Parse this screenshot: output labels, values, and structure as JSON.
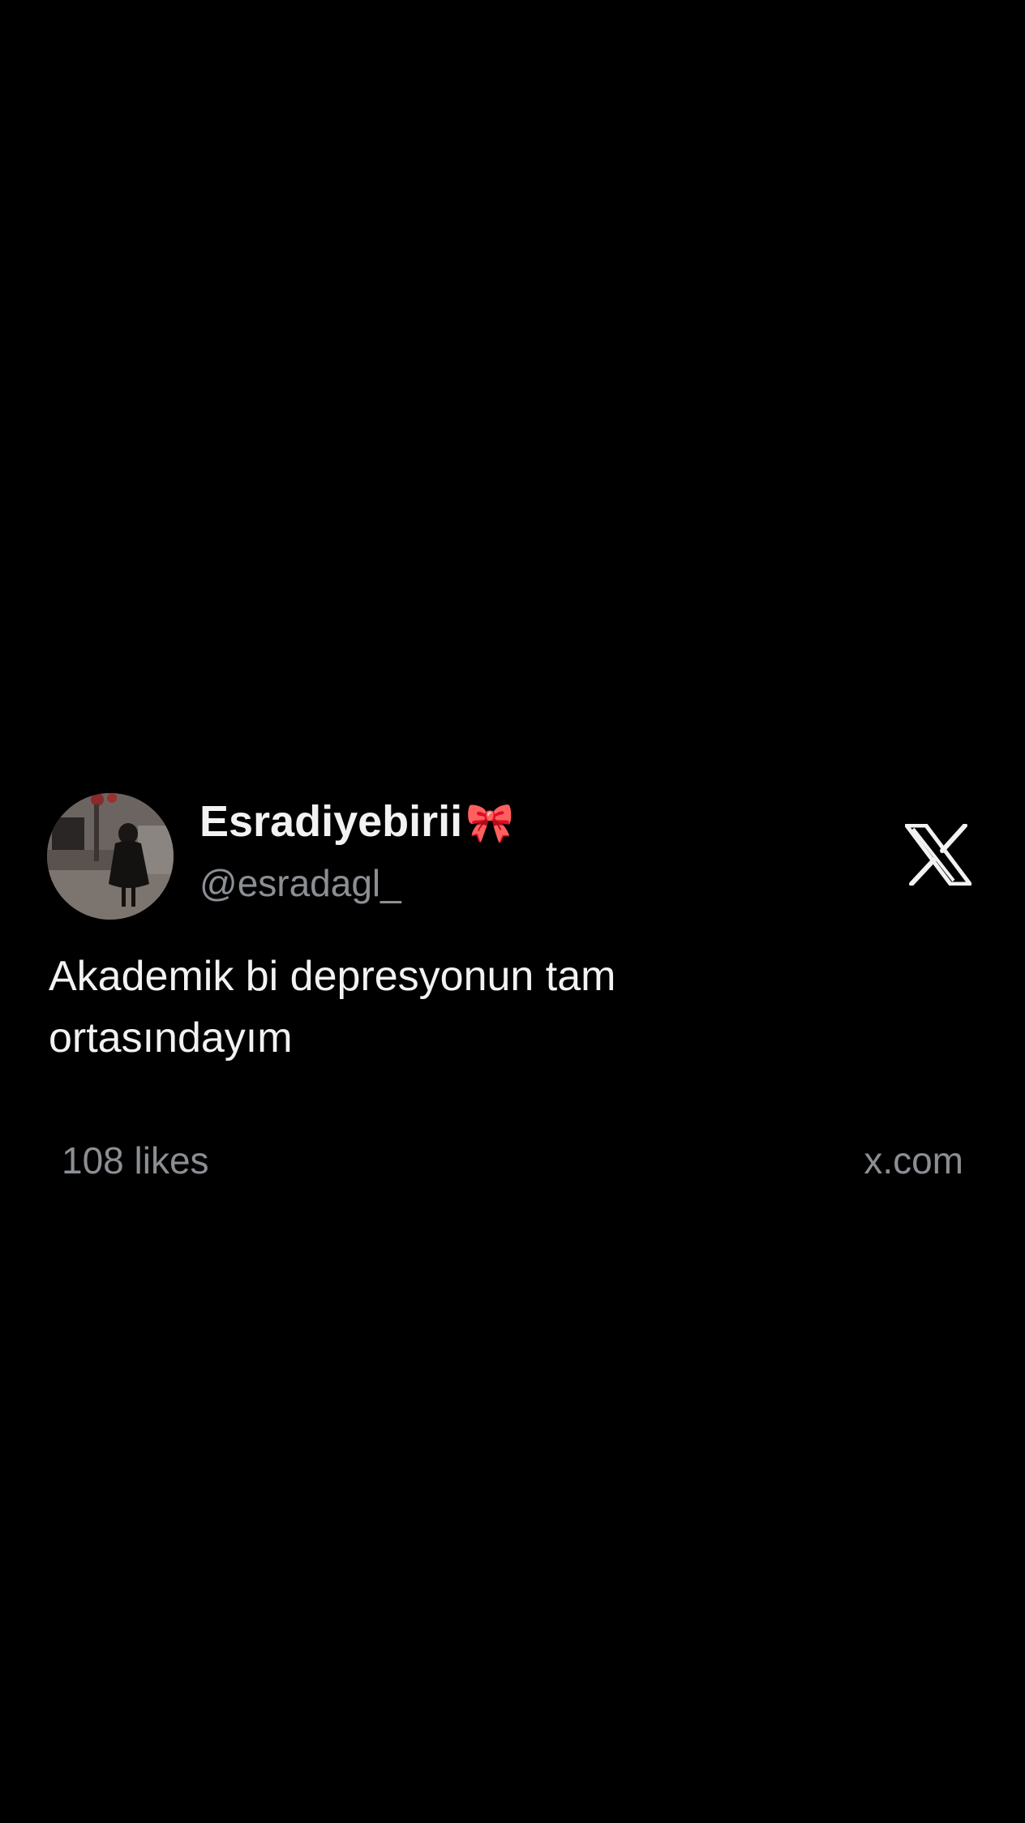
{
  "post": {
    "display_name": "Esradiyebirii",
    "name_emoji": "🎀",
    "handle": "@esradagl_",
    "text_line1": "Akademik bi depresyonun tam",
    "text_line2": "ortasındayım",
    "likes": "108 likes",
    "source": "x.com"
  },
  "icons": {
    "brand": "x-logo-icon",
    "avatar": "profile-photo"
  },
  "colors": {
    "background": "#000000",
    "primary_text": "#f2f2f2",
    "secondary_text": "#8b8f94"
  }
}
